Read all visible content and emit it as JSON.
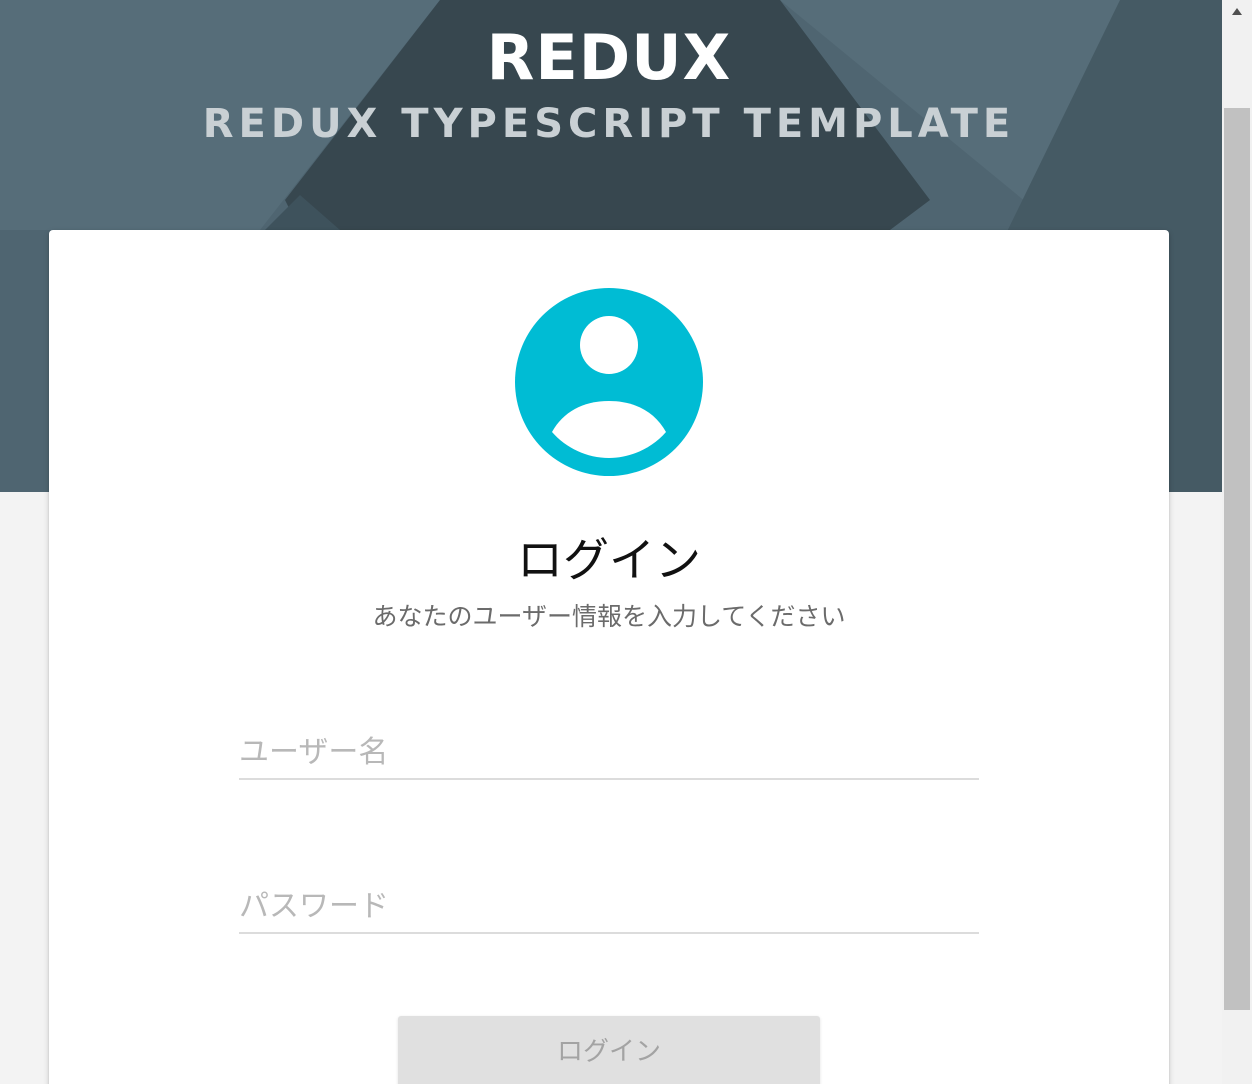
{
  "header": {
    "title": "REDUX",
    "subtitle": "REDUX TYPESCRIPT TEMPLATE"
  },
  "login_card": {
    "avatar_icon": "account-circle-icon",
    "title": "ログイン",
    "subtitle": "あなたのユーザー情報を入力してください",
    "username": {
      "value": "",
      "placeholder": "ユーザー名"
    },
    "password": {
      "value": "",
      "placeholder": "パスワード"
    },
    "submit_label": "ログイン"
  },
  "colors": {
    "header_bg": "#4d6370",
    "header_dark": "#37474f",
    "avatar_accent": "#00bcd4",
    "button_disabled_bg": "#e0e0e0",
    "button_disabled_text": "#a3a3a3",
    "page_bg": "#f3f3f3"
  }
}
